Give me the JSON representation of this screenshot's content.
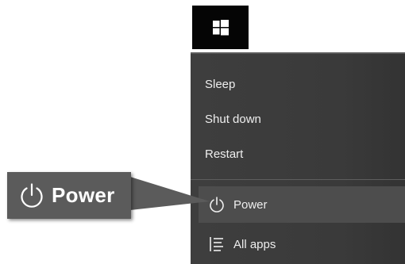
{
  "start": {
    "icon": "windows-logo-icon"
  },
  "menu": {
    "items": [
      {
        "label": "Sleep"
      },
      {
        "label": "Shut down"
      },
      {
        "label": "Restart"
      }
    ],
    "power": {
      "label": "Power",
      "icon": "power-icon"
    },
    "all_apps": {
      "label": "All apps",
      "icon": "list-icon"
    }
  },
  "callout": {
    "label": "Power",
    "icon": "power-icon"
  },
  "colors": {
    "menu_background": "#3a3a3a",
    "highlight": "#4d4d4d",
    "callout_background": "#5b5b5b",
    "text": "#eeeeee"
  }
}
